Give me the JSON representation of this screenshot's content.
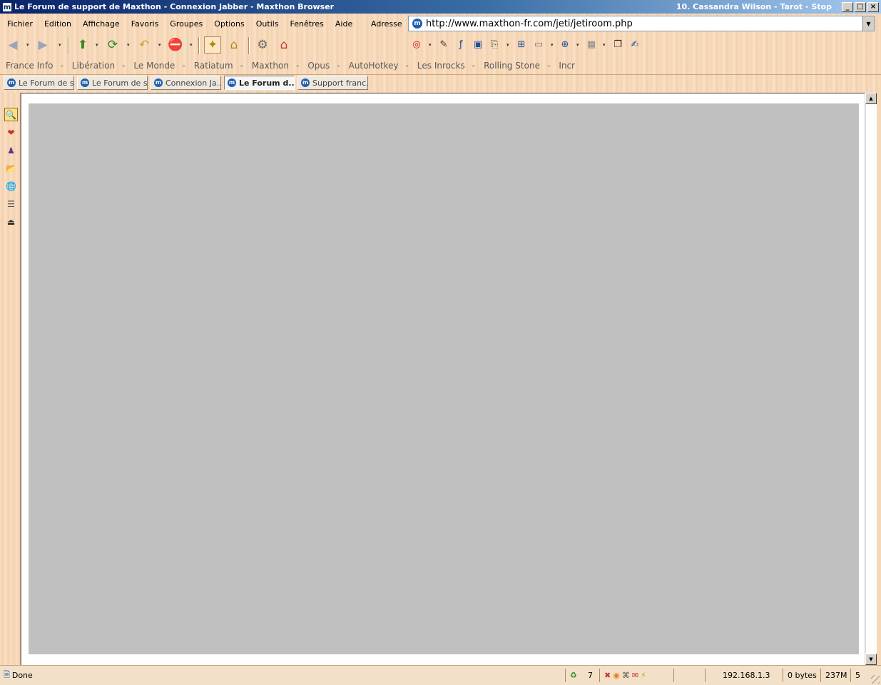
{
  "window": {
    "title": "Le Forum de support de Maxthon - Connexion Jabber - Maxthon Browser",
    "now_playing": "10. Cassandra Wilson - Tarot - Stop",
    "minimize": "_",
    "maximize": "□",
    "close": "×",
    "app_icon": "m"
  },
  "menu": {
    "items": [
      "Fichier",
      "Edition",
      "Affichage",
      "Favoris",
      "Groupes",
      "Options",
      "Outils",
      "Fenêtres",
      "Aide"
    ]
  },
  "address": {
    "label": "Adresse",
    "url": "http://www.maxthon-fr.com/jeti/jetiroom.php",
    "site_icon": "m",
    "dropdown": "▼"
  },
  "toolbar": {
    "back_icon": "◀",
    "forward_icon": "▶",
    "up_icon": "⬆",
    "refresh_icon": "⟳",
    "history_icon": "↶",
    "stop_icon": "⛔",
    "dropdown": "▾",
    "mark_icon": "✦",
    "home_icon": "⌂",
    "options_icon": "⚙",
    "popup_icon": "◎",
    "pen_icon": "✎",
    "flash_icon": "ƒ",
    "screen_icon": "▣",
    "copy_icon": "⎘",
    "split_icon": "⊞",
    "window_icon": "▭",
    "zoom_icon": "⊕",
    "image_icon": "▦",
    "cascade_icon": "❐",
    "note_icon": "✍"
  },
  "links": {
    "items": [
      "France Info",
      "Libération",
      "Le Monde",
      "Ratiatum",
      "Maxthon",
      "Opus",
      "AutoHotkey",
      "Les Inrocks",
      "Rolling Stone",
      "Incr"
    ],
    "separator": "-"
  },
  "tabs": [
    {
      "label": "Le Forum de s...",
      "active": false
    },
    {
      "label": "Le Forum de s...",
      "active": false
    },
    {
      "label": "Connexion Ja...",
      "active": false
    },
    {
      "label": "Le Forum d...",
      "active": true
    },
    {
      "label": "Support franc...",
      "active": false
    }
  ],
  "sidebar": {
    "icons": [
      "🔍",
      "❤",
      "♟",
      "📂",
      "🌐",
      "☰",
      "⏏"
    ]
  },
  "scrollbar": {
    "up": "▲",
    "down": "▼"
  },
  "status": {
    "text": "Done",
    "page_icon": "🗎",
    "recycle_icon": "♻",
    "tab_count": "7",
    "ip": "192.168.1.3",
    "bytes": "0 bytes",
    "memory": "237M",
    "last": "5",
    "addon_icons": [
      "✖",
      "◉",
      "⌘",
      "✉",
      "⚡"
    ]
  },
  "colors": {
    "titlebar_start": "#0a246a",
    "titlebar_end": "#a6caf0",
    "content_panel": "#c0c0c0",
    "wood": "#f7dcc0",
    "stop_red": "#d01010",
    "refresh_green": "#2a8a2a"
  }
}
